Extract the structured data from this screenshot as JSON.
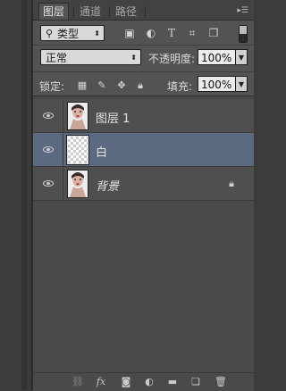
{
  "tabs": [
    {
      "label": "图层",
      "active": true
    },
    {
      "label": "通道",
      "active": false
    },
    {
      "label": "路径",
      "active": false
    }
  ],
  "filter": {
    "kind_label": "类型",
    "kind_icon": "search-icon",
    "filter_icons": [
      "image-filter-icon",
      "adjustment-filter-icon",
      "text-filter-icon",
      "shape-filter-icon",
      "smart-object-filter-icon"
    ]
  },
  "blend": {
    "mode": "正常",
    "opacity_label": "不透明度:",
    "opacity_value": "100%"
  },
  "lock": {
    "label": "锁定:",
    "icons": [
      "lock-transparent-pixels-icon",
      "lock-image-pixels-icon",
      "lock-position-icon",
      "lock-all-icon"
    ],
    "fill_label": "填充:",
    "fill_value": "100%"
  },
  "layers": [
    {
      "name": "图层 1",
      "visible": true,
      "selected": false,
      "thumb": "portrait",
      "locked": false,
      "italic": false
    },
    {
      "name": "白",
      "visible": true,
      "selected": true,
      "thumb": "transparent",
      "locked": false,
      "italic": false
    },
    {
      "name": "背景",
      "visible": true,
      "selected": false,
      "thumb": "portrait",
      "locked": true,
      "italic": true
    }
  ],
  "bottom_icons": [
    "link-layers-icon",
    "fx-icon",
    "add-mask-icon",
    "adjustment-layer-icon",
    "new-group-icon",
    "new-layer-icon",
    "delete-layer-icon"
  ],
  "colors": {
    "panel_bg": "#535353",
    "selected_layer": "#5b6a80"
  }
}
